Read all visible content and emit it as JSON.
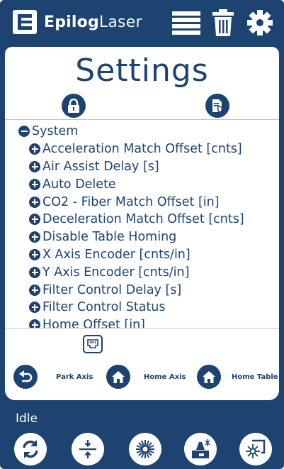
{
  "header": {
    "logo_bold": "Epilog",
    "logo_light": "Laser",
    "icons": [
      "list-icon",
      "trash-icon",
      "gear-icon"
    ]
  },
  "page": {
    "title": "Settings"
  },
  "tree": {
    "root_label": "System",
    "items": [
      "Acceleration Match Offset [cnts]",
      "Air Assist Delay [s]",
      "Auto Delete",
      "CO2 - Fiber Match Offset [in]",
      "Deceleration Match Offset [cnts]",
      "Disable Table Homing",
      "X Axis Encoder [cnts/in]",
      "Y Axis Encoder [cnts/in]",
      "Filter Control Delay [s]",
      "Filter Control Status",
      "Home Offset [in]"
    ]
  },
  "axis": {
    "park_label": "Park Axis",
    "home_axis_label": "Home Axis",
    "home_table_label": "Home Table"
  },
  "status": {
    "text": "Idle"
  },
  "bottom_icons": [
    "refresh-icon",
    "focus-icon",
    "laser-icon",
    "job-icon",
    "pointer-icon"
  ],
  "colors": {
    "primary": "#1d4370",
    "surface": "#ffffff"
  }
}
